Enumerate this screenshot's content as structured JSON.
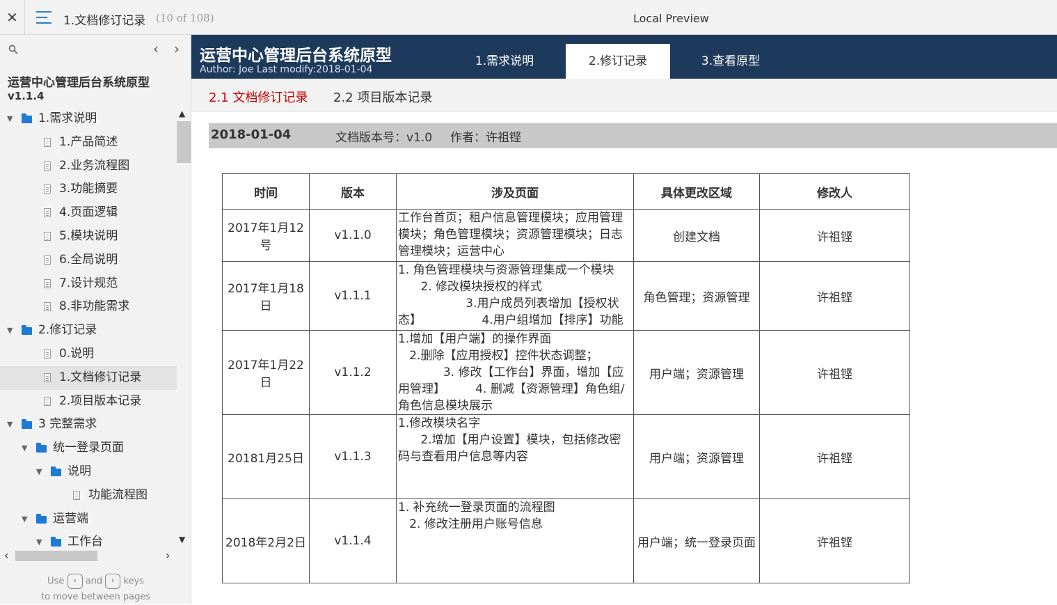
{
  "topbar": {
    "close": "✕",
    "title": "1.文档修订记录",
    "count": "(10 of 108)",
    "center": "Local Preview"
  },
  "sidebar": {
    "project": "运营中心管理后台系统原型",
    "version": "v1.1.4",
    "items": [
      {
        "label": "1.需求说明",
        "type": "folder",
        "level": 0
      },
      {
        "label": "1.产品简述",
        "type": "page",
        "level": 1
      },
      {
        "label": "2.业务流程图",
        "type": "page",
        "level": 1
      },
      {
        "label": "3.功能摘要",
        "type": "page",
        "level": 1
      },
      {
        "label": "4.页面逻辑",
        "type": "page",
        "level": 1
      },
      {
        "label": "5.模块说明",
        "type": "page",
        "level": 1
      },
      {
        "label": "6.全局说明",
        "type": "page",
        "level": 1
      },
      {
        "label": "7.设计规范",
        "type": "page",
        "level": 1
      },
      {
        "label": "8.非功能需求",
        "type": "page",
        "level": 1
      },
      {
        "label": "2.修订记录",
        "type": "folder",
        "level": 0
      },
      {
        "label": "0.说明",
        "type": "page",
        "level": 1
      },
      {
        "label": "1.文档修订记录",
        "type": "page",
        "level": 1,
        "selected": true
      },
      {
        "label": "2.项目版本记录",
        "type": "page",
        "level": 1
      },
      {
        "label": "3 完整需求",
        "type": "folder",
        "level": 0
      },
      {
        "label": "统一登录页面",
        "type": "folder",
        "level": 1
      },
      {
        "label": "说明",
        "type": "folder",
        "level": 2
      },
      {
        "label": "功能流程图",
        "type": "page",
        "level": 3
      },
      {
        "label": "运营端",
        "type": "folder",
        "level": 1
      },
      {
        "label": "工作台",
        "type": "folder",
        "level": 2
      }
    ],
    "keys_hint_1": "Use",
    "keys_hint_and": "and",
    "keys_hint_2": "keys",
    "keys_hint_3": "to move between pages"
  },
  "header": {
    "title": "运营中心管理后台系统原型",
    "meta": "Author: Joe    Last modify:2018-01-04",
    "tabs": [
      "1.需求说明",
      "2.修订记录",
      "3.查看原型"
    ],
    "active_tab": 1
  },
  "subnav": {
    "items": [
      "2.1 文档修订记录",
      "2.2 项目版本记录"
    ],
    "active": 0
  },
  "datebar": {
    "date": "2018-01-04",
    "doc_version": "文档版本号：v1.0",
    "author": "作者：许祖铿"
  },
  "table": {
    "headers": [
      "时间",
      "版本",
      "涉及页面",
      "具体更改区域",
      "修改人"
    ],
    "rows": [
      {
        "time": "2017年1月12号",
        "version": "v1.1.0",
        "pages": [
          "工作台首页；租户信息管理模块；应用管理模块；角色管理模块；资源管理模块；日志管理模块；运营中心"
        ],
        "area": "创建文档",
        "author": "许祖铿"
      },
      {
        "time": "2017年1月18日",
        "version": "v1.1.1",
        "pages": [
          "1. 角色管理模块与资源管理集成一个模块",
          "      2. 修改模块授权的样式",
          "                  3.用户成员列表增加【授权状态】                4.用户组增加【排序】功能"
        ],
        "area": "角色管理；资源管理",
        "author": "许祖铿"
      },
      {
        "time": "2017年1月22日",
        "version": "v1.1.2",
        "pages": [
          "1.增加【用户端】的操作界面",
          "   2.删除【应用授权】控件状态调整；",
          "            3. 修改【工作台】界面，增加【应用管理】        4. 删减【资源管理】角色组/角色信息模块展示"
        ],
        "area": "用户端；资源管理",
        "author": "许祖铿"
      },
      {
        "time": "20181月25日",
        "version": "v1.1.3",
        "pages": [
          "1.修改模块名字",
          "      2.增加【用户设置】模块，包括修改密码与查看用户信息等内容"
        ],
        "area": "用户端；资源管理",
        "author": "许祖铿"
      },
      {
        "time": "2018年2月2日",
        "version": "v1.1.4",
        "pages": [
          "1. 补充统一登录页面的流程图",
          "   2. 修改注册用户账号信息"
        ],
        "area": "用户端；统一登录页面",
        "author": "许祖铿"
      }
    ]
  },
  "colors": {
    "header_bg": "#1d3a5c",
    "active_subnav": "#cc0000",
    "folder_icon": "#1e7ad6",
    "menu_icon": "#2a7fc9"
  }
}
